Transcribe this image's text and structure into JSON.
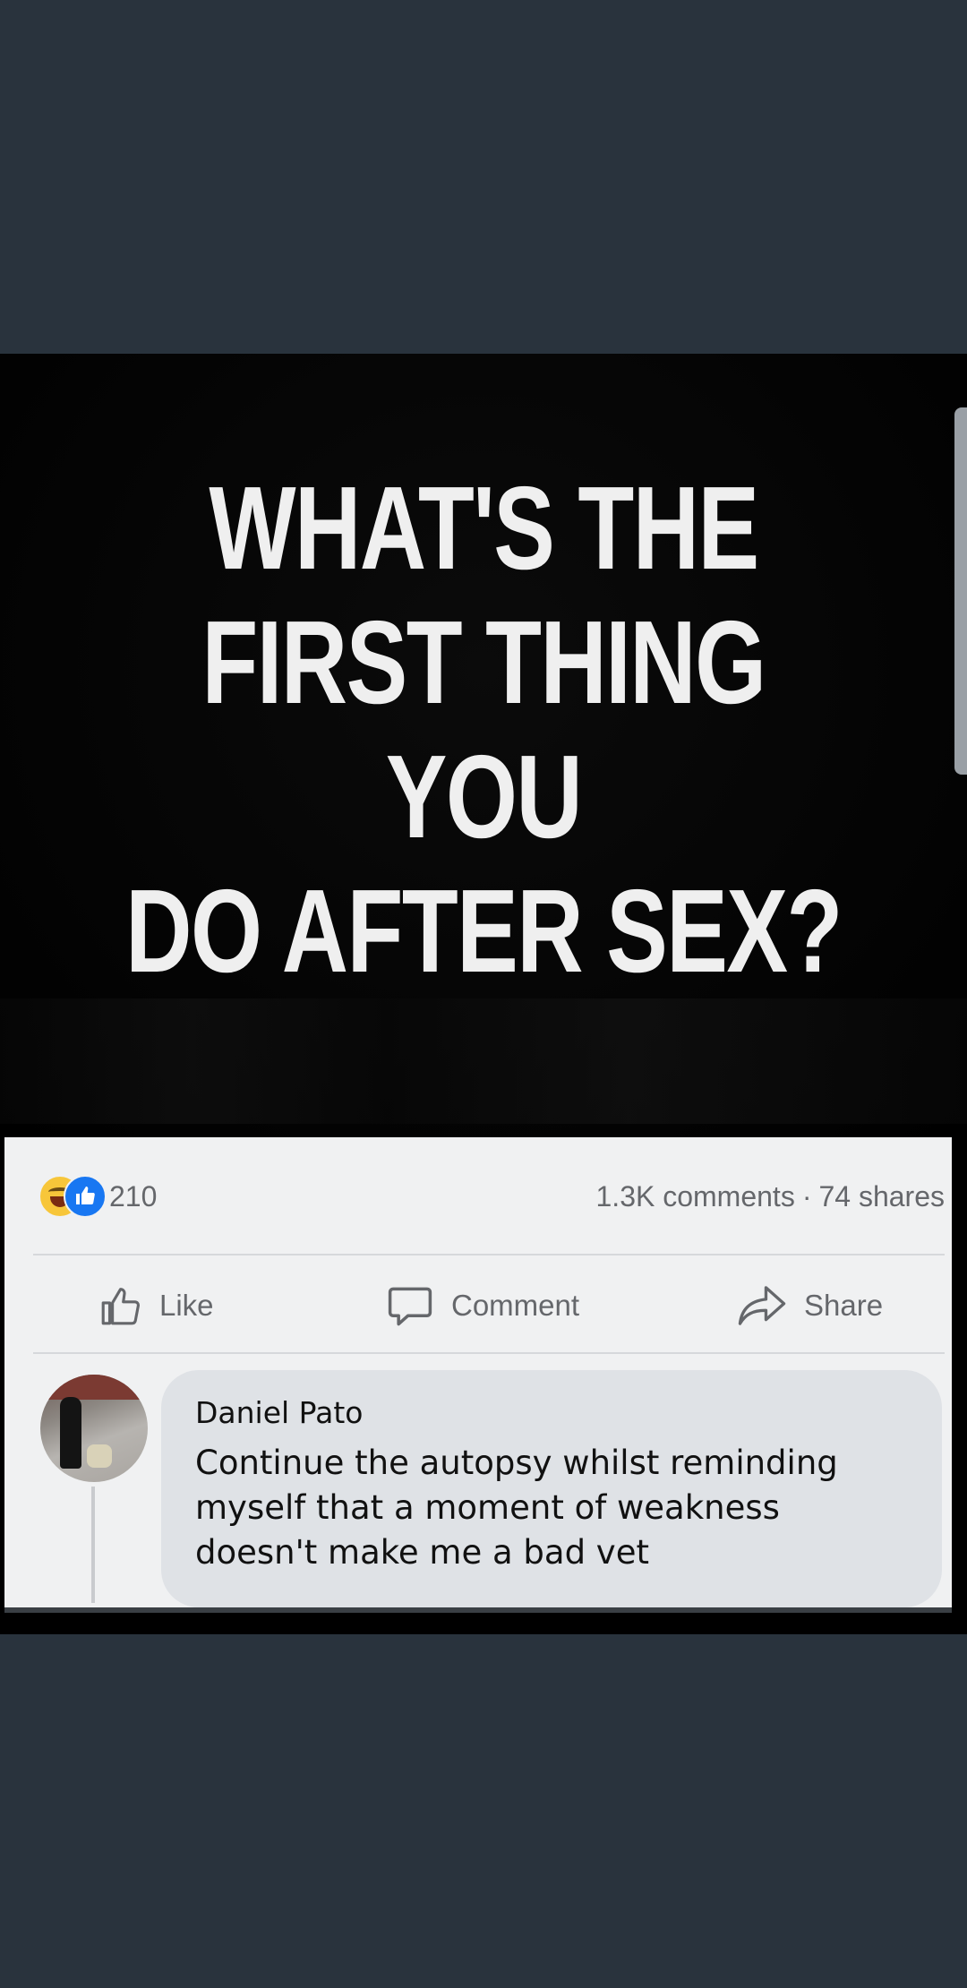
{
  "post": {
    "headline_lines": [
      "WHAT'S THE",
      "FIRST THING YOU",
      "DO AFTER SEX?"
    ]
  },
  "stats": {
    "reaction_icons": [
      "haha-icon",
      "like-icon"
    ],
    "reaction_count": "210",
    "comments": "1.3K comments",
    "separator": "·",
    "shares": "74 shares"
  },
  "actions": {
    "like_label": "Like",
    "comment_label": "Comment",
    "share_label": "Share"
  },
  "comment": {
    "author": "Daniel Pato",
    "text": "Continue the autopsy whilst reminding\nmyself that a moment of weakness\ndoesn't make me a bad vet"
  },
  "colors": {
    "background": "#29333d",
    "card": "#f0f1f2",
    "bubble": "#dfe2e6",
    "like_blue": "#1877f2",
    "haha_yellow": "#f7c63a",
    "muted_text": "#65676b"
  }
}
